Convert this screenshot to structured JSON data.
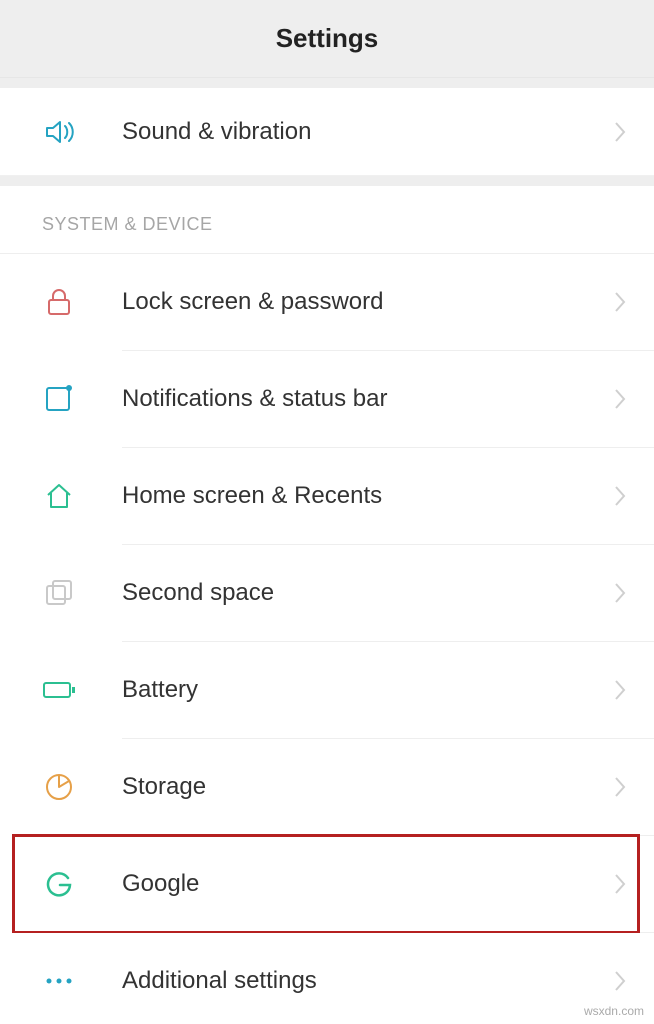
{
  "header": {
    "title": "Settings"
  },
  "top": {
    "sound": {
      "label": "Sound & vibration"
    }
  },
  "system": {
    "title": "SYSTEM & DEVICE",
    "lock": {
      "label": "Lock screen & password"
    },
    "notifications": {
      "label": "Notifications & status bar"
    },
    "home": {
      "label": "Home screen & Recents"
    },
    "second_space": {
      "label": "Second space"
    },
    "battery": {
      "label": "Battery"
    },
    "storage": {
      "label": "Storage"
    },
    "google": {
      "label": "Google"
    },
    "additional": {
      "label": "Additional settings"
    }
  },
  "watermark": "wsxdn.com"
}
